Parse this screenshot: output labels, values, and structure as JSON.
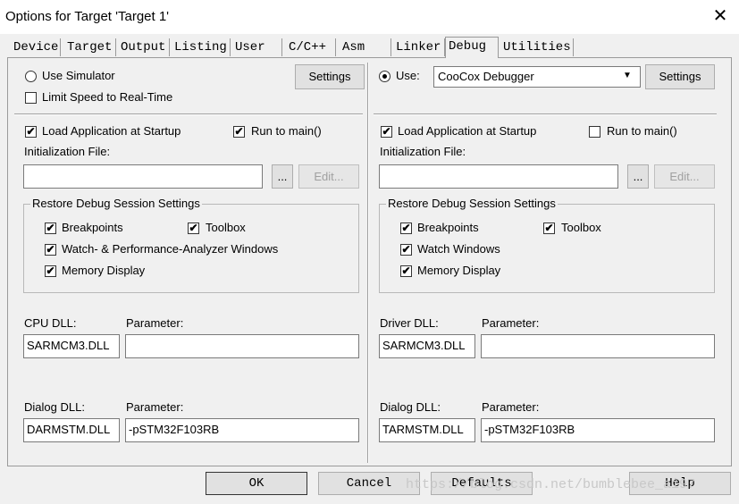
{
  "window": {
    "title": "Options for Target 'Target 1'",
    "close_glyph": "✕"
  },
  "tabs": [
    "Device",
    "Target",
    "Output",
    "Listing",
    "User",
    "C/C++",
    "Asm",
    "Linker",
    "Debug",
    "Utilities"
  ],
  "active_tab": "Debug",
  "left": {
    "use_simulator": "Use Simulator",
    "limit_speed": "Limit Speed to Real-Time",
    "settings": "Settings",
    "load_app": "Load Application at Startup",
    "run_to_main": "Run to main()",
    "init_file_label": "Initialization File:",
    "browse": "...",
    "edit": "Edit...",
    "restore_group": "Restore Debug Session Settings",
    "breakpoints": "Breakpoints",
    "toolbox": "Toolbox",
    "watch": "Watch- & Performance-Analyzer Windows",
    "memory": "Memory Display",
    "cpu_dll_label": "CPU DLL:",
    "cpu_dll_value": "SARMCM3.DLL",
    "param_label": "Parameter:",
    "cpu_param_value": "",
    "dialog_dll_label": "Dialog DLL:",
    "dialog_dll_value": "DARMSTM.DLL",
    "dialog_param_value": "-pSTM32F103RB"
  },
  "right": {
    "use": "Use:",
    "debugger": "CooCox Debugger",
    "settings": "Settings",
    "load_app": "Load Application at Startup",
    "run_to_main": "Run to main()",
    "init_file_label": "Initialization File:",
    "browse": "...",
    "edit": "Edit...",
    "restore_group": "Restore Debug Session Settings",
    "breakpoints": "Breakpoints",
    "toolbox": "Toolbox",
    "watch": "Watch Windows",
    "memory": "Memory Display",
    "driver_dll_label": "Driver DLL:",
    "driver_dll_value": "SARMCM3.DLL",
    "param_label": "Parameter:",
    "driver_param_value": "",
    "dialog_dll_label": "Dialog DLL:",
    "dialog_dll_value": "TARMSTM.DLL",
    "dialog_param_value": "-pSTM32F103RB"
  },
  "footer": {
    "ok": "OK",
    "cancel": "Cancel",
    "defaults": "Defaults",
    "help": "Help"
  },
  "watermark": "https://blog.csdn.net/bumblebee_ai97",
  "check_glyph": "✔",
  "dropdown_glyph": "▼"
}
